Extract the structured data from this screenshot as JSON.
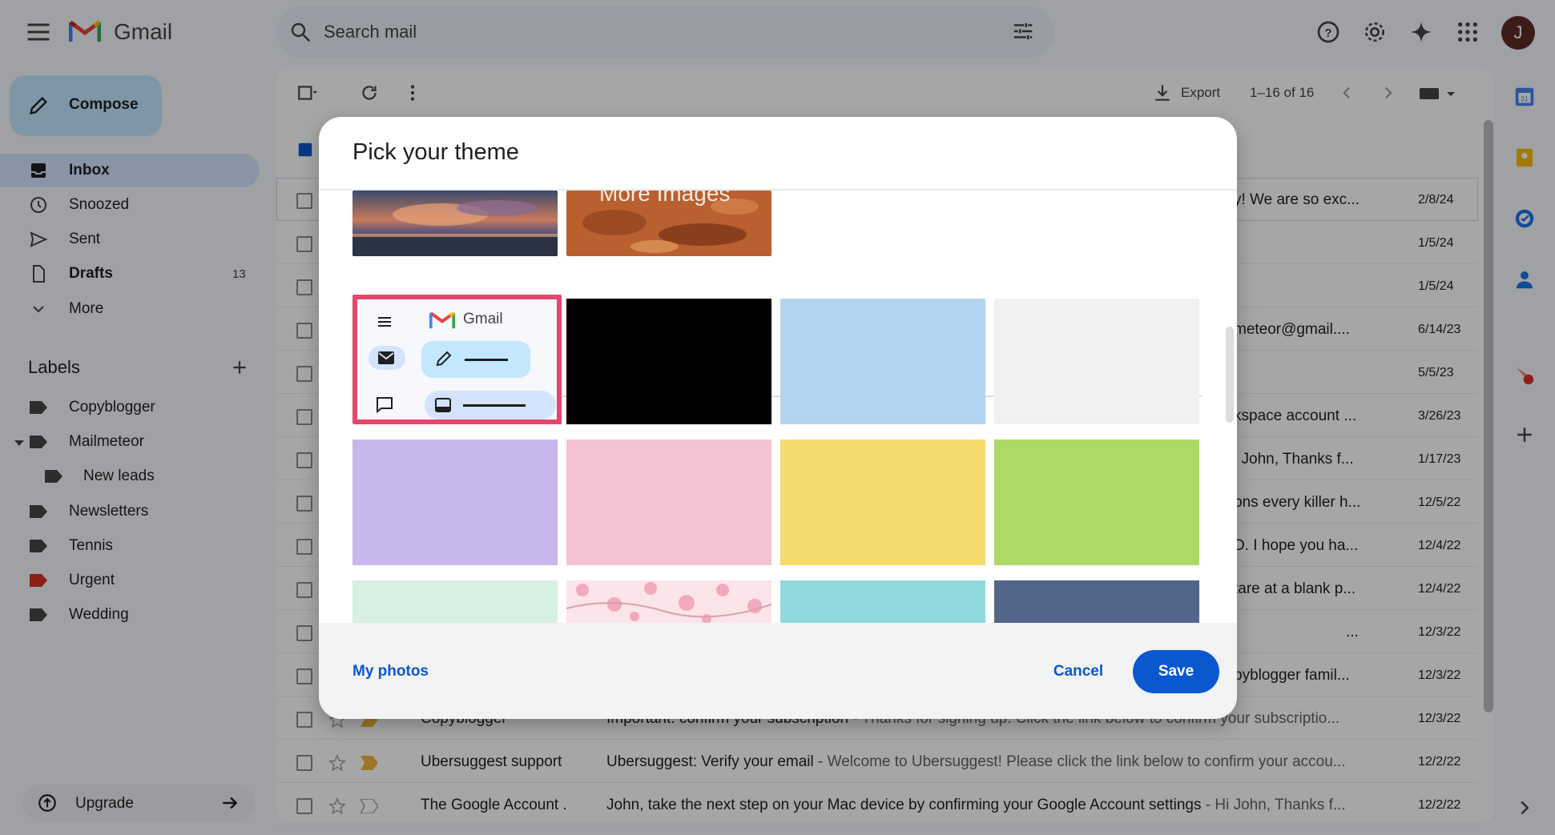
{
  "app": {
    "name": "Gmail",
    "avatar_letter": "J"
  },
  "search": {
    "placeholder": "Search mail"
  },
  "nav": {
    "compose": "Compose",
    "items": [
      {
        "label": "Inbox",
        "count": ""
      },
      {
        "label": "Snoozed",
        "count": ""
      },
      {
        "label": "Sent",
        "count": ""
      },
      {
        "label": "Drafts",
        "count": "13"
      },
      {
        "label": "More",
        "count": ""
      }
    ],
    "labels_title": "Labels",
    "labels": [
      {
        "label": "Copyblogger",
        "color": "#444746"
      },
      {
        "label": "Mailmeteor",
        "color": "#444746"
      },
      {
        "label": "New leads",
        "color": "#444746"
      },
      {
        "label": "Newsletters",
        "color": "#444746"
      },
      {
        "label": "Tennis",
        "color": "#444746"
      },
      {
        "label": "Urgent",
        "color": "#d93025"
      },
      {
        "label": "Wedding",
        "color": "#444746"
      }
    ],
    "upgrade": "Upgrade"
  },
  "toolbar": {
    "export": "Export",
    "pager": "1–16 of 16"
  },
  "rows": [
    {
      "tail": "y! We are so exc...",
      "date": "2/8/24"
    },
    {
      "tail": "",
      "date": "1/5/24"
    },
    {
      "tail": "",
      "date": "1/5/24"
    },
    {
      "tail": "meteor@gmail....",
      "date": "6/14/23"
    },
    {
      "tail": "",
      "date": "5/5/23"
    },
    {
      "tail": "kspace account ...",
      "date": "3/26/23"
    },
    {
      "tail": "i John, Thanks f...",
      "date": "1/17/23"
    },
    {
      "tail": "ons every killer h...",
      "date": "12/5/22"
    },
    {
      "tail": "D. I hope you ha...",
      "date": "12/4/22"
    },
    {
      "tail": "tare at a blank p...",
      "date": "12/4/22"
    },
    {
      "tail": "...",
      "date": "12/3/22"
    },
    {
      "tail": "pyblogger famil...",
      "date": "12/3/22"
    }
  ],
  "full_rows": [
    {
      "sender": "Copyblogger",
      "subject": "Important: confirm your subscription",
      "snippet": " - Thanks for signing up. Click the link below to confirm your subscriptio...",
      "date": "12/3/22"
    },
    {
      "sender": "Ubersuggest support",
      "subject": "Ubersuggest: Verify your email",
      "snippet": " - Welcome to Ubersuggest! Please click the link below to confirm your accou...",
      "date": "12/2/22"
    },
    {
      "sender": "The Google Account .",
      "subject": "John, take the next step on your Mac device by confirming your Google Account settings",
      "snippet": " - Hi John, Thanks f...",
      "date": "12/2/22"
    }
  ],
  "dialog": {
    "title": "Pick your theme",
    "more_images": "More Images",
    "preview_app_name": "Gmail",
    "swatches": [
      {
        "name": "black",
        "color": "#000000"
      },
      {
        "name": "light-blue",
        "color": "#b3d4ef"
      },
      {
        "name": "light-gray",
        "color": "#f1f1f1"
      },
      {
        "name": "lavender",
        "color": "#c9b6ea"
      },
      {
        "name": "pink",
        "color": "#f4c2d3"
      },
      {
        "name": "yellow",
        "color": "#f5da6c"
      },
      {
        "name": "lime",
        "color": "#aed967"
      },
      {
        "name": "mint",
        "color": "#d8f0e3"
      },
      {
        "name": "cherry-blossom",
        "color": "#fbe4ea"
      },
      {
        "name": "turquoise",
        "color": "#8fd9df"
      },
      {
        "name": "slate-blue",
        "color": "#53668a"
      }
    ],
    "my_photos": "My photos",
    "cancel": "Cancel",
    "save": "Save"
  },
  "colors": {
    "accent": "#0b57d0",
    "selection": "#e8456e"
  }
}
